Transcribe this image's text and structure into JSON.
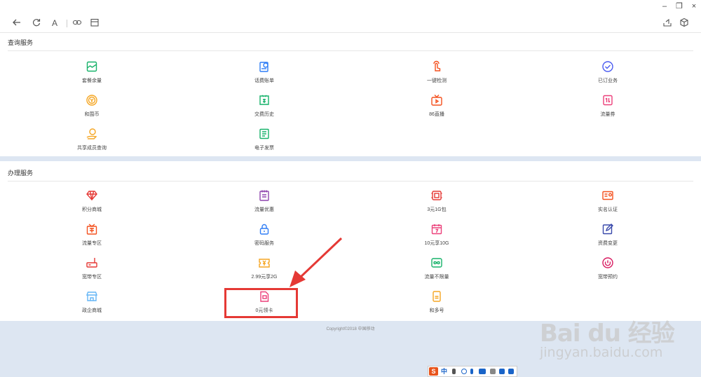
{
  "window": {
    "minimize_glyph": "–",
    "restore_glyph": "❐",
    "close_glyph": "×"
  },
  "toolbar": {
    "back_icon": "arrow-left-icon",
    "refresh_icon": "refresh-icon",
    "font_label": "A",
    "link_icon": "link-icon",
    "calendar_icon": "calendar-icon",
    "share_icon": "share-icon",
    "box_icon": "cube-icon"
  },
  "query_section": {
    "title": "查询服务",
    "items": [
      {
        "label": "套餐余量",
        "icon": "package-balance-icon",
        "color": "#17b26a"
      },
      {
        "label": "话费账单",
        "icon": "bill-icon",
        "color": "#2f7df6"
      },
      {
        "label": "一键检测",
        "icon": "tap-hand-icon",
        "color": "#f4511e"
      },
      {
        "label": "已订业务",
        "icon": "check-circle-icon",
        "color": "#4a5bf0"
      },
      {
        "label": "和围币",
        "icon": "coin-icon",
        "color": "#f5a623"
      },
      {
        "label": "交费历史",
        "icon": "payment-history-icon",
        "color": "#17b26a"
      },
      {
        "label": "86直播",
        "icon": "tv-live-icon",
        "color": "#f4511e"
      },
      {
        "label": "流量券",
        "icon": "traffic-coupon-icon",
        "color": "#ec407a"
      },
      {
        "label": "共享成员查询",
        "icon": "shared-member-icon",
        "color": "#f5a623"
      },
      {
        "label": "电子发票",
        "icon": "invoice-icon",
        "color": "#17b26a"
      }
    ]
  },
  "handle_section": {
    "title": "办理服务",
    "items": [
      {
        "label": "积分商城",
        "icon": "diamond-icon",
        "color": "#e53935"
      },
      {
        "label": "流量优惠",
        "icon": "notepad-icon",
        "color": "#8e44ad"
      },
      {
        "label": "3元1G包",
        "icon": "data-pack-icon",
        "color": "#e53935"
      },
      {
        "label": "实名认证",
        "icon": "id-card-icon",
        "color": "#f4511e"
      },
      {
        "label": "流量专区",
        "icon": "gift-hui-icon",
        "color": "#f4511e"
      },
      {
        "label": "密码服务",
        "icon": "lock-icon",
        "color": "#2f7df6"
      },
      {
        "label": "10元享10G",
        "icon": "calendar-seven-icon",
        "color": "#ec407a"
      },
      {
        "label": "资费变更",
        "icon": "edit-icon",
        "color": "#3949ab"
      },
      {
        "label": "宽带专区",
        "icon": "router-icon",
        "color": "#e53935"
      },
      {
        "label": "2.99元享2G",
        "icon": "yuan-ticket-icon",
        "color": "#f5a623"
      },
      {
        "label": "流量不限量",
        "icon": "infinity-icon",
        "color": "#17b26a"
      },
      {
        "label": "宽带预约",
        "icon": "power-icon",
        "color": "#d81b60"
      },
      {
        "label": "政企商城",
        "icon": "store-icon",
        "color": "#64b5f6"
      },
      {
        "label": "0元领卡",
        "icon": "sim-card-icon",
        "color": "#ec407a"
      },
      {
        "label": "和多号",
        "icon": "multi-number-icon",
        "color": "#f5a623"
      }
    ]
  },
  "footer": {
    "copyright": "Copyright©2018 中国移动"
  },
  "ime": {
    "logo": "S",
    "lang": "中"
  },
  "watermark": {
    "logo": "Bai du 经验",
    "url": "jingyan.baidu.com"
  }
}
